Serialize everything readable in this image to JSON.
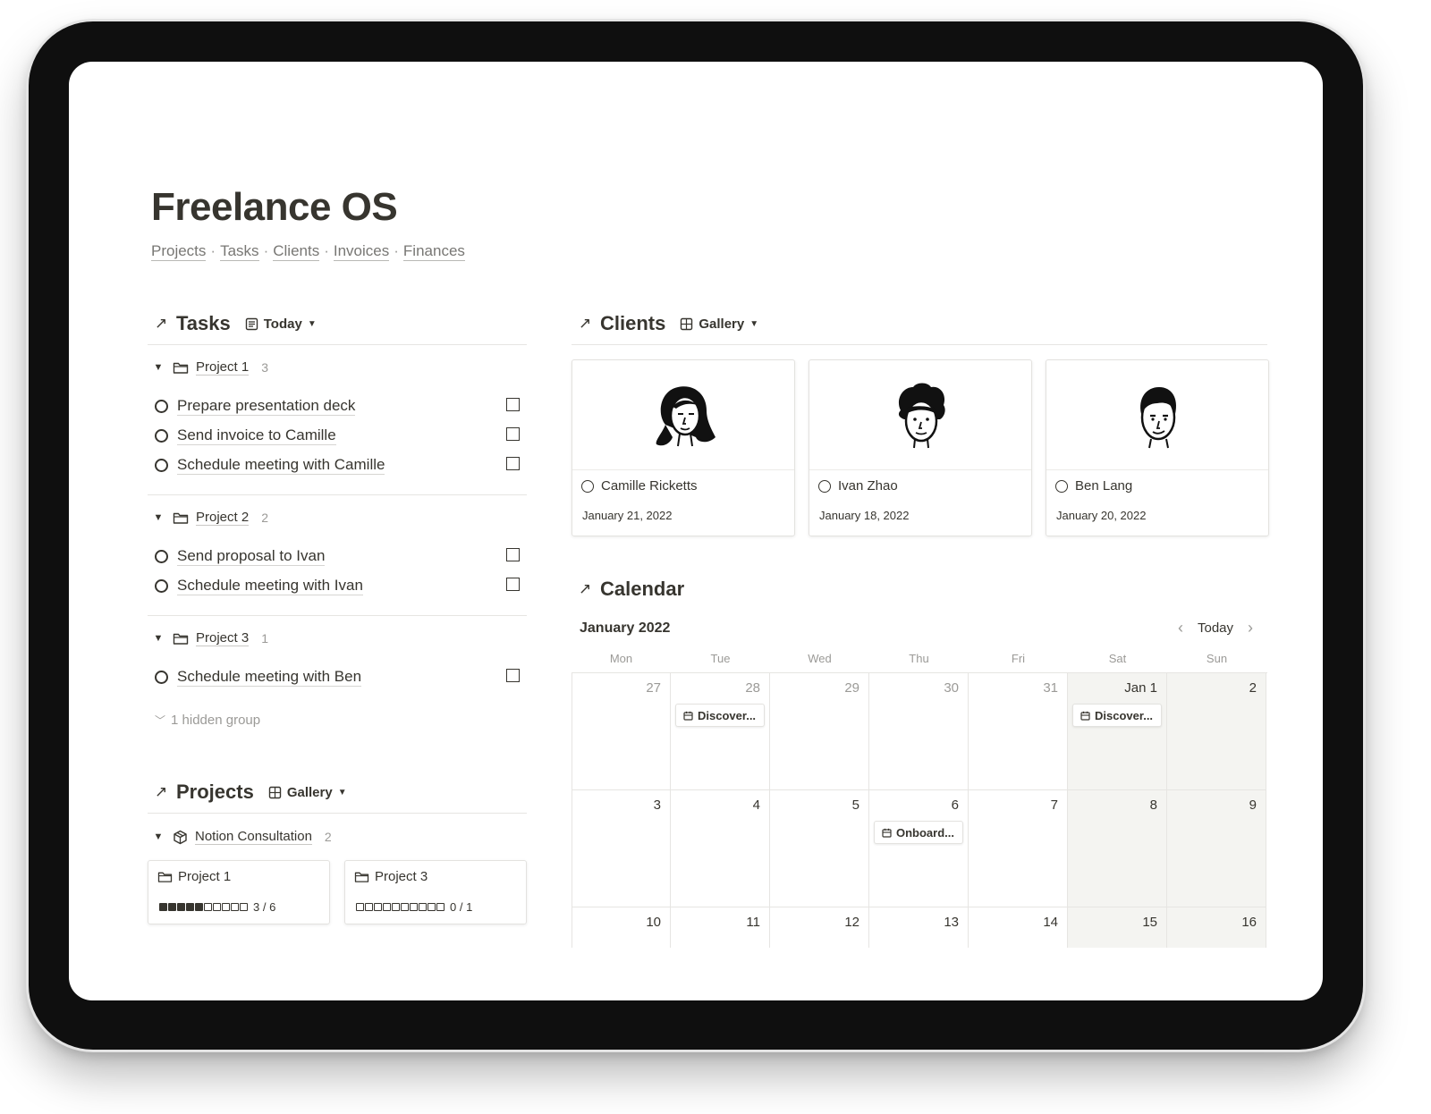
{
  "page": {
    "title": "Freelance OS",
    "nav_links": [
      "Projects",
      "Tasks",
      "Clients",
      "Invoices",
      "Finances"
    ],
    "nav_separator": "·"
  },
  "tasks": {
    "title": "Tasks",
    "view_label": "Today",
    "groups": [
      {
        "label": "Project 1",
        "count": "3",
        "items": [
          "Prepare presentation deck",
          "Send invoice to Camille",
          "Schedule meeting with Camille"
        ]
      },
      {
        "label": "Project 2",
        "count": "2",
        "items": [
          "Send proposal to Ivan",
          "Schedule meeting with Ivan"
        ]
      },
      {
        "label": "Project 3",
        "count": "1",
        "items": [
          "Schedule meeting with Ben"
        ]
      }
    ],
    "hidden_groups_label": "1 hidden group"
  },
  "projects": {
    "title": "Projects",
    "view_label": "Gallery",
    "group": {
      "label": "Notion Consultation",
      "count": "2"
    },
    "cards": [
      {
        "title": "Project 1",
        "progress_text": "3 / 6",
        "progress_fraction": 0.5
      },
      {
        "title": "Project 3",
        "progress_text": "0 / 1",
        "progress_fraction": 0
      }
    ]
  },
  "clients": {
    "title": "Clients",
    "view_label": "Gallery",
    "cards": [
      {
        "name": "Camille Ricketts",
        "date": "January 21, 2022",
        "avatar": "woman-avatar-illustration"
      },
      {
        "name": "Ivan Zhao",
        "date": "January 18, 2022",
        "avatar": "curly-hair-man-avatar-illustration"
      },
      {
        "name": "Ben Lang",
        "date": "January 20, 2022",
        "avatar": "man-avatar-illustration"
      }
    ]
  },
  "calendar": {
    "title": "Calendar",
    "month_label": "January 2022",
    "today_label": "Today",
    "weekdays": [
      "Mon",
      "Tue",
      "Wed",
      "Thu",
      "Fri",
      "Sat",
      "Sun"
    ],
    "weeks": [
      [
        "27",
        "28",
        "29",
        "30",
        "31",
        "Jan 1",
        "2"
      ],
      [
        "3",
        "4",
        "5",
        "6",
        "7",
        "8",
        "9"
      ],
      [
        "10",
        "11",
        "12",
        "13",
        "14",
        "15",
        "16"
      ]
    ],
    "events": [
      {
        "label": "Discover...",
        "week": 0,
        "day": 1
      },
      {
        "label": "Discover...",
        "week": 0,
        "day": 5
      },
      {
        "label": "Onboard...",
        "week": 1,
        "day": 3
      }
    ]
  },
  "icons": {
    "section_arrow": "arrow-up-right-icon",
    "list_view": "list-view-icon",
    "gallery_view": "gallery-grid-icon",
    "folder": "folder-icon",
    "package": "package-icon",
    "calendar_event": "calendar-event-icon"
  }
}
